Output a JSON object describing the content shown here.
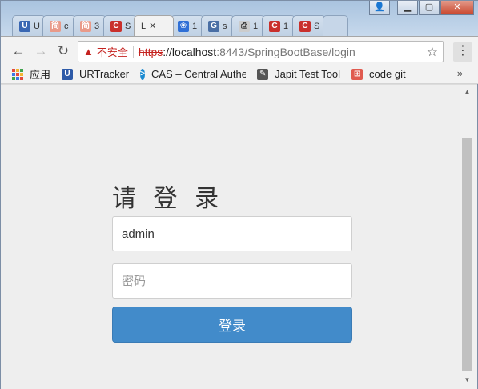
{
  "browser": {
    "tabs": [
      {
        "label": "U",
        "icon": "ur-tracker-icon",
        "color": "#3a67b3"
      },
      {
        "label": "c",
        "icon": "jianshu-icon",
        "color": "#e99a89"
      },
      {
        "label": "3",
        "icon": "jianshu-icon",
        "color": "#e99a89"
      },
      {
        "label": "S",
        "icon": "c-logo-icon",
        "color": "#c9302c"
      },
      {
        "label": "L",
        "icon": "blank-page-icon",
        "color": "#ffffff",
        "active": true
      },
      {
        "label": "1",
        "icon": "paw-icon",
        "color": "#2f6fd6"
      },
      {
        "label": "s",
        "icon": "g-logo-icon",
        "color": "#4a6fa5"
      },
      {
        "label": "1",
        "icon": "blank-page-icon",
        "color": "#dddddd"
      },
      {
        "label": "1",
        "icon": "c-logo-icon",
        "color": "#c9302c"
      },
      {
        "label": "S",
        "icon": "c-logo-icon",
        "color": "#c9302c"
      }
    ],
    "tab_icon_text": {
      "u": "U",
      "jian": "简",
      "c": "C",
      "paw": "❀",
      "g": "G",
      "doc": "⎙"
    },
    "omnibox": {
      "warning_icon": "▲",
      "insecure_label": "不安全",
      "scheme": "https",
      "host_prefix": "://localhost",
      "path": ":8443/SpringBootBase/login"
    },
    "bookmarks": [
      {
        "label": "应用",
        "icon": "apps-grid-icon"
      },
      {
        "label": "URTracker",
        "icon": "ur-tracker-icon",
        "icon_text": "U",
        "color": "#2d5aa8"
      },
      {
        "label": "CAS – Central Authe",
        "icon": "cas-icon",
        "icon_text": ">",
        "color": "#1b8ad1"
      },
      {
        "label": "Japit Test Tool",
        "icon": "japit-icon",
        "icon_text": "✎",
        "color": "#555555"
      },
      {
        "label": "code git",
        "icon": "code-git-icon",
        "icon_text": "⊞",
        "color": "#e05a4f"
      }
    ],
    "bookmarks_more": "»"
  },
  "login": {
    "title": "请 登 录",
    "username_value": "admin",
    "password_placeholder": "密码",
    "submit_label": "登录"
  },
  "colors": {
    "primary": "#428bca",
    "insecure": "#c5221f"
  }
}
